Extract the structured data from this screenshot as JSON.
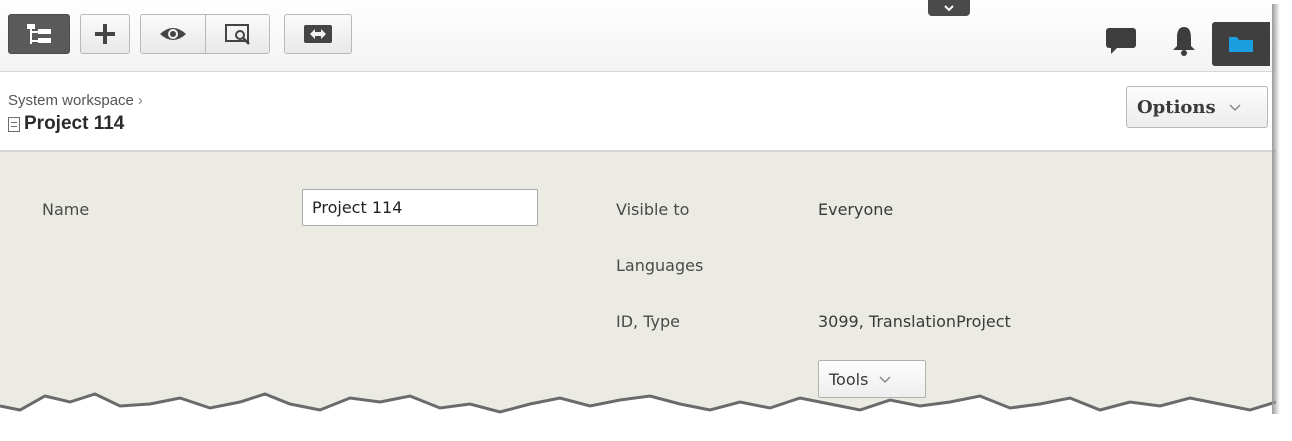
{
  "toolbar": {
    "buttons": [
      {
        "icon": "tree-structure-icon"
      },
      {
        "icon": "plus-icon"
      },
      {
        "icon": "eye-icon"
      },
      {
        "icon": "preview-icon"
      },
      {
        "icon": "compare-icon"
      }
    ],
    "right_icons": [
      "comment-icon",
      "bell-icon",
      "folder-icon"
    ],
    "accent_color": "#1a9ee0"
  },
  "header": {
    "breadcrumb": "System workspace",
    "breadcrumb_separator": "›",
    "title": "Project 114",
    "options_label": "Options"
  },
  "form": {
    "name_label": "Name",
    "name_value": "Project 114",
    "visible_label": "Visible to",
    "visible_value": "Everyone",
    "languages_label": "Languages",
    "id_type_label": "ID, Type",
    "id_type_value": "3099, TranslationProject",
    "tools_label": "Tools"
  },
  "colors": {
    "content_bg": "#ebebe4",
    "folder_bg": "#3f3f3f",
    "dark_button": "#5a5a5a"
  }
}
